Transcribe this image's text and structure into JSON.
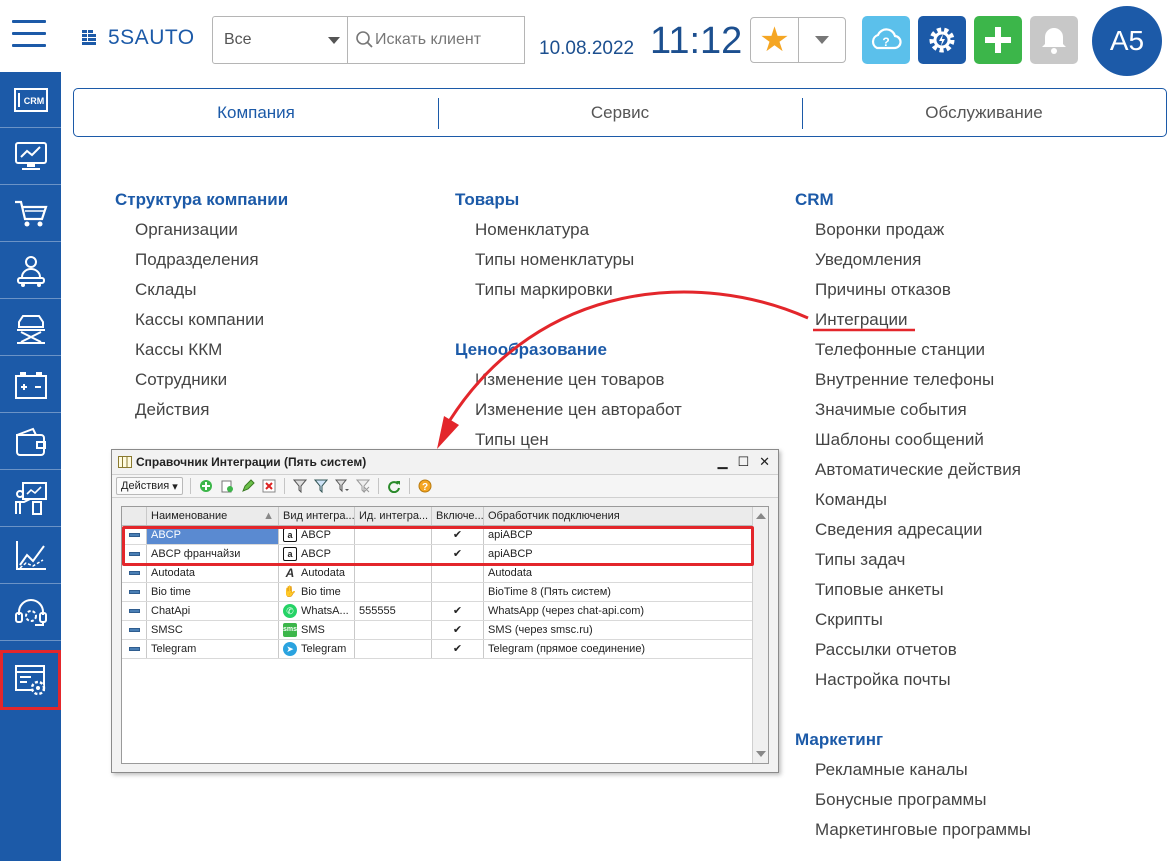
{
  "header": {
    "logo_text": "5SAUTO",
    "filter_select": "Все",
    "search_placeholder": "Искать клиент",
    "date": "10.08.2022",
    "time": "11:12",
    "avatar_initials": "A5"
  },
  "colors": {
    "brand": "#1c5aa8",
    "accent_red": "#e3262b",
    "star": "#f5a623",
    "help": "#5bc0eb",
    "green": "#3cb64a",
    "bell": "#c8c8c8"
  },
  "sidebar": {
    "items": [
      {
        "icon": "crm-icon",
        "label": "CRM"
      },
      {
        "icon": "dashboard-monitor-icon"
      },
      {
        "icon": "cart-icon"
      },
      {
        "icon": "mechanic-icon"
      },
      {
        "icon": "car-lift-icon"
      },
      {
        "icon": "battery-icon"
      },
      {
        "icon": "wallet-icon"
      },
      {
        "icon": "presentation-icon"
      },
      {
        "icon": "chart-line-icon"
      },
      {
        "icon": "support-headset-icon"
      },
      {
        "icon": "settings-window-icon",
        "active": true
      }
    ]
  },
  "tabs": [
    {
      "label": "Компания",
      "active": true
    },
    {
      "label": "Сервис"
    },
    {
      "label": "Обслуживание"
    }
  ],
  "menu": {
    "col1": {
      "sections": [
        {
          "title": "Структура компании",
          "links": [
            "Организации",
            "Подразделения",
            "Склады",
            "Кассы компании",
            "Кассы ККМ",
            "Сотрудники",
            "Действия"
          ]
        }
      ]
    },
    "col2": {
      "sections": [
        {
          "title": "Товары",
          "links": [
            "Номенклатура",
            "Типы номенклатуры",
            "Типы маркировки"
          ]
        },
        {
          "title": "Ценообразование",
          "links": [
            "Изменение цен товаров",
            "Изменение цен авторабот",
            "Типы цен"
          ]
        }
      ]
    },
    "col3": {
      "sections": [
        {
          "title": "CRM",
          "links": [
            "Воронки продаж",
            "Уведомления",
            "Причины отказов",
            "Интеграции",
            "Телефонные станции",
            "Внутренние телефоны",
            "Значимые события",
            "Шаблоны сообщений",
            "Автоматические действия",
            "Команды",
            "Сведения адресации",
            "Типы задач",
            "Типовые анкеты",
            "Скрипты",
            "Рассылки отчетов",
            "Настройка почты"
          ]
        },
        {
          "title": "Маркетинг",
          "links": [
            "Рекламные каналы",
            "Бонусные программы",
            "Маркетинговые программы"
          ]
        }
      ]
    }
  },
  "window": {
    "title": "Справочник Интеграции (Пять систем)",
    "actions_label": "Действия",
    "columns": [
      "Наименование",
      "Вид интегра...",
      "Ид. интегра...",
      "Включе...",
      "Обработчик подключения"
    ],
    "rows": [
      {
        "name": "ABCP",
        "type": "ABCP",
        "id": "",
        "enabled": "✔",
        "handler": "apiABCP",
        "type_icon": "abcp-icon"
      },
      {
        "name": "ABCP франчайзи",
        "type": "ABCP",
        "id": "",
        "enabled": "✔",
        "handler": "apiABCP",
        "type_icon": "abcp-icon"
      },
      {
        "name": "Autodata",
        "type": "Autodata",
        "id": "",
        "enabled": "",
        "handler": "Autodata",
        "type_icon": "autodata-icon"
      },
      {
        "name": "Bio time",
        "type": "Bio time",
        "id": "",
        "enabled": "",
        "handler": "BioTime 8 (Пять систем)",
        "type_icon": "biotime-icon"
      },
      {
        "name": "ChatApi",
        "type": "WhatsA...",
        "id": "555555",
        "enabled": "✔",
        "handler": "WhatsApp (через chat-api.com)",
        "type_icon": "whatsapp-icon"
      },
      {
        "name": "SMSC",
        "type": "SMS",
        "id": "",
        "enabled": "✔",
        "handler": "SMS (через smsc.ru)",
        "type_icon": "sms-icon"
      },
      {
        "name": "Telegram",
        "type": "Telegram",
        "id": "",
        "enabled": "✔",
        "handler": "Telegram (прямое соединение)",
        "type_icon": "telegram-icon"
      }
    ]
  }
}
